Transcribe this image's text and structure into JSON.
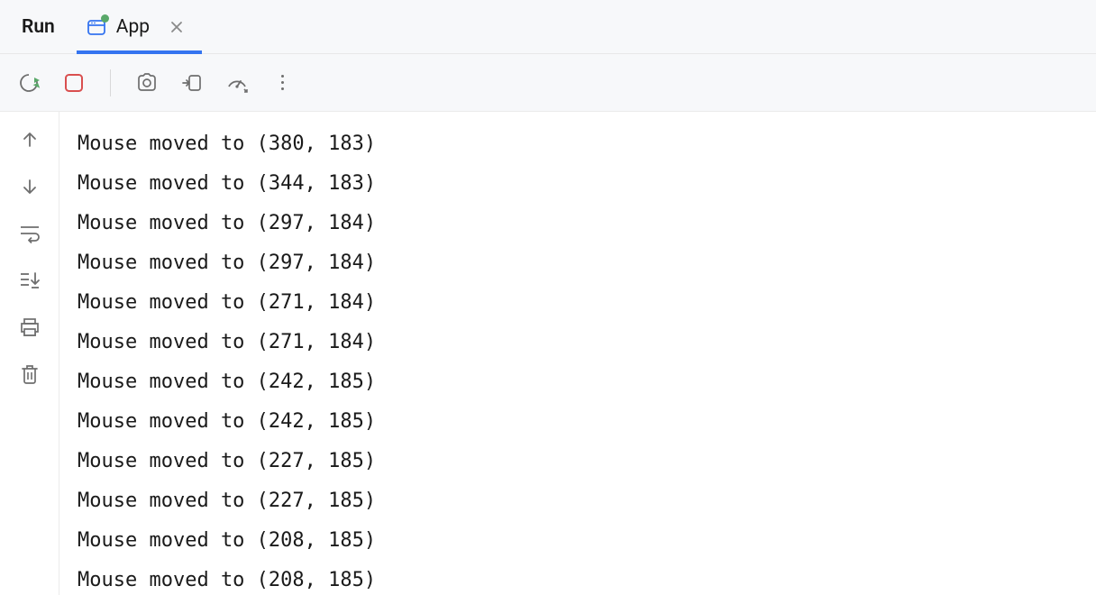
{
  "header": {
    "title": "Run",
    "tab": {
      "label": "App",
      "running": true
    }
  },
  "toolbar": {
    "rerun": "Rerun",
    "stop": "Stop",
    "screenshot": "Layout Inspector",
    "attach": "Attach Debugger",
    "profile": "Profile",
    "more": "More"
  },
  "gutter": {
    "up": "Up the Stack Trace",
    "down": "Down the Stack Trace",
    "wrap": "Soft-Wrap",
    "scroll": "Scroll to End",
    "print": "Print",
    "clear": "Clear All"
  },
  "console": {
    "lines": [
      "Mouse moved to (380, 183)",
      "Mouse moved to (344, 183)",
      "Mouse moved to (297, 184)",
      "Mouse moved to (297, 184)",
      "Mouse moved to (271, 184)",
      "Mouse moved to (271, 184)",
      "Mouse moved to (242, 185)",
      "Mouse moved to (242, 185)",
      "Mouse moved to (227, 185)",
      "Mouse moved to (227, 185)",
      "Mouse moved to (208, 185)",
      "Mouse moved to (208, 185)"
    ]
  }
}
